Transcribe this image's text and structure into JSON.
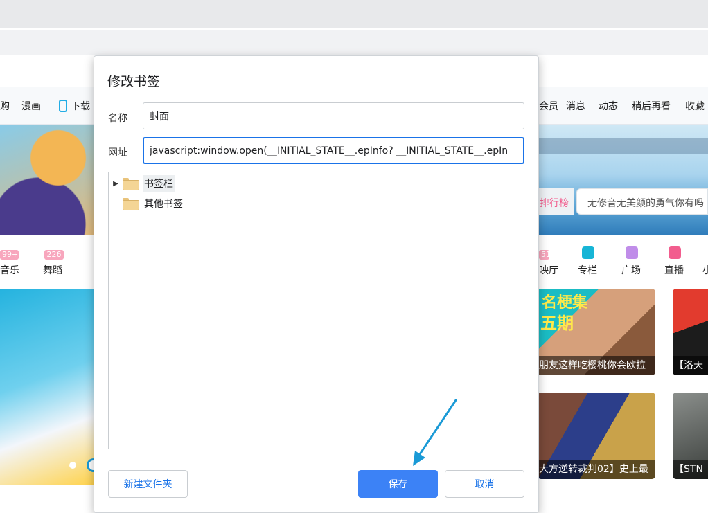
{
  "page_bg": {
    "nav_items_left": [
      "购",
      "漫画"
    ],
    "download_label": "下载",
    "nav_items_right": [
      "会员",
      "消息",
      "动态",
      "稍后再看",
      "收藏"
    ],
    "rank_label": "排行榜",
    "search_placeholder": "无修音无美颜的勇气你有吗",
    "categories_left": [
      {
        "badge": "99+",
        "label": "音乐"
      },
      {
        "badge": "226",
        "label": "舞蹈"
      }
    ],
    "categories_right": [
      {
        "badge": "51",
        "label": "映厅"
      },
      {
        "label": "专栏",
        "icon_color": "#17b5d6"
      },
      {
        "label": "广场",
        "icon_color": "#c08de9"
      },
      {
        "label": "直播",
        "icon_color": "#f25d8e"
      },
      {
        "label": "小"
      }
    ],
    "thumbs": [
      {
        "caption": "朋友这样吃樱桃你会欧拉",
        "overlay_text": "名梗集",
        "overlay_sub": "五期"
      },
      {
        "caption": "【洛天"
      },
      {
        "caption": "大方逆转裁判02】史上最"
      },
      {
        "caption": "【STN"
      }
    ]
  },
  "dialog": {
    "title": "修改书签",
    "name_label": "名称",
    "name_value": "封面",
    "url_label": "网址",
    "url_value": "javascript:window.open(__INITIAL_STATE__.epInfo? __INITIAL_STATE__.epIn",
    "tree": [
      {
        "label": "书签栏",
        "expandable": true,
        "selected": true
      },
      {
        "label": "其他书签",
        "expandable": false,
        "selected": false
      }
    ],
    "new_folder_label": "新建文件夹",
    "save_label": "保存",
    "cancel_label": "取消"
  },
  "colors": {
    "primary": "#3c82f6",
    "link": "#1a73e8",
    "annotation_arrow": "#1a9ad6",
    "rank_pink": "#f25d8e"
  }
}
